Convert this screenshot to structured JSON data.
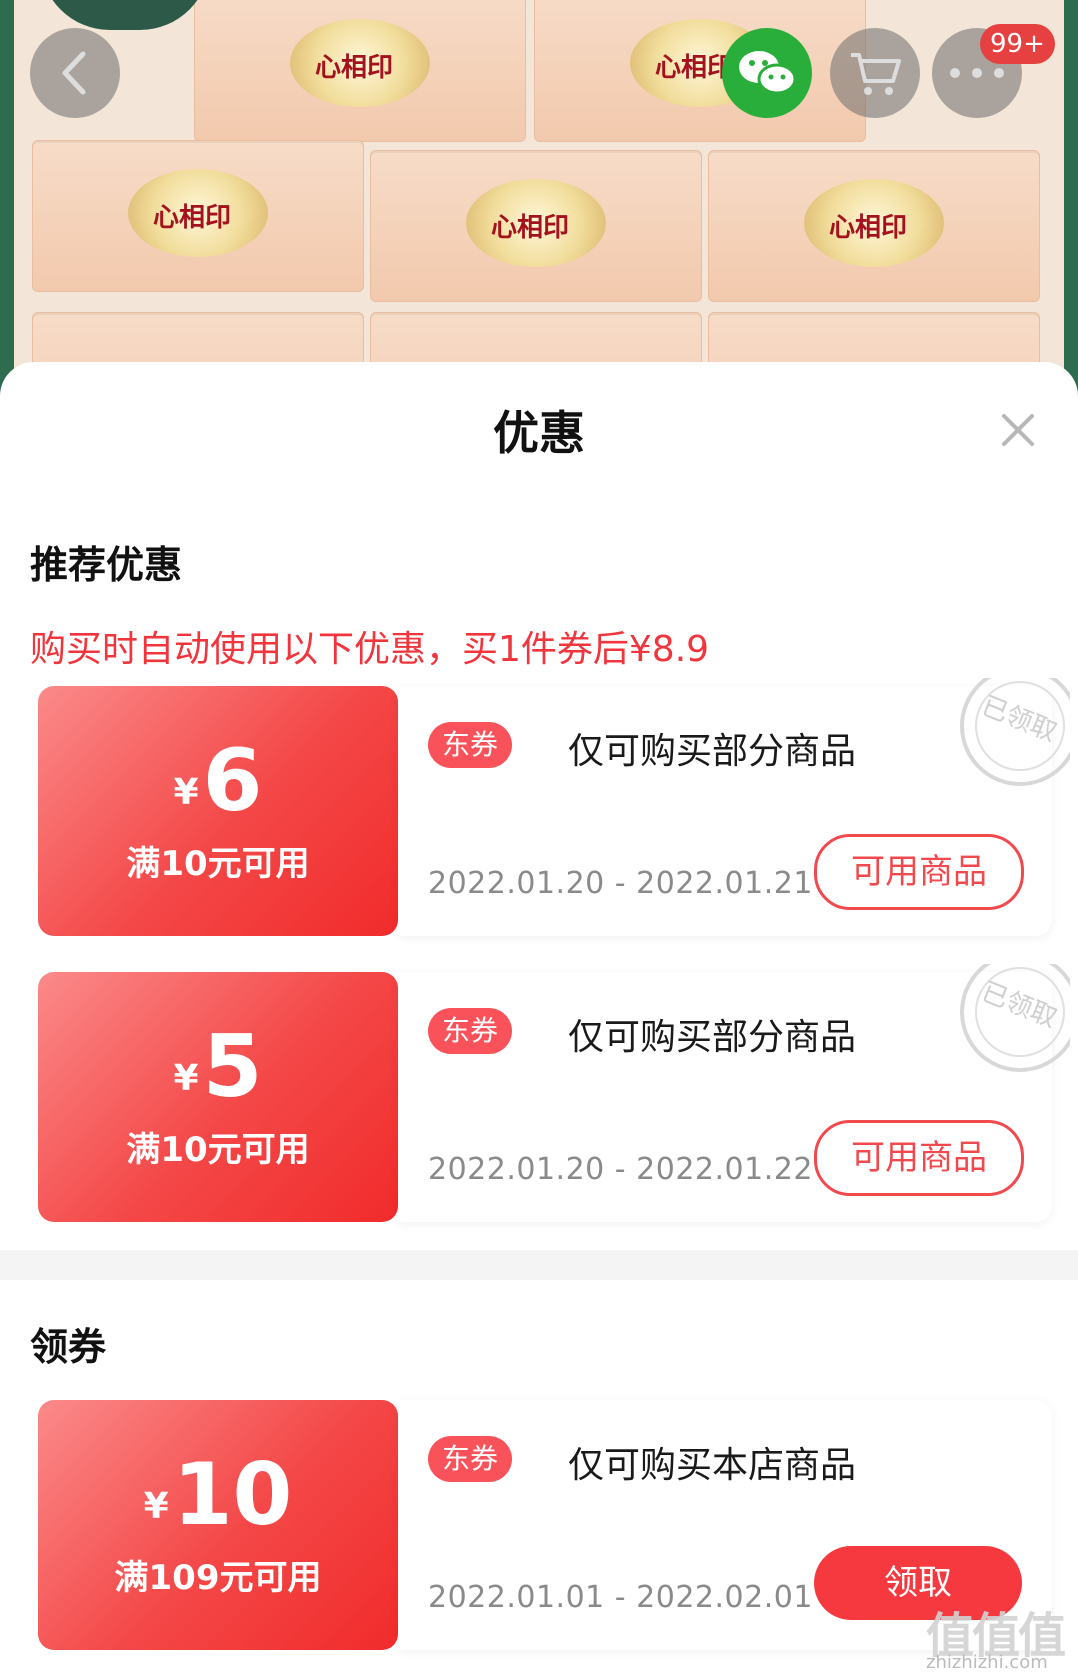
{
  "hero": {
    "brand_text": "心相印",
    "cart_badge": "99+"
  },
  "sheet": {
    "title": "优惠",
    "recommended_section_title": "推荐优惠",
    "notice": "购买时自动使用以下优惠，买1件券后¥8.9",
    "claim_section_title": "领券"
  },
  "coupons_recommended": [
    {
      "currency": "¥",
      "amount": "6",
      "condition": "满10元可用",
      "tag": "东券",
      "description": "仅可购买部分商品",
      "date_range": "2022.01.20 - 2022.01.21",
      "action_label": "可用商品",
      "stamp_text": "已领取"
    },
    {
      "currency": "¥",
      "amount": "5",
      "condition": "满10元可用",
      "tag": "东券",
      "description": "仅可购买部分商品",
      "date_range": "2022.01.20 - 2022.01.22",
      "action_label": "可用商品",
      "stamp_text": "已领取"
    }
  ],
  "coupons_claim": [
    {
      "currency": "¥",
      "amount": "10",
      "condition": "满109元可用",
      "tag": "东券",
      "description": "仅可购买本店商品",
      "date_range": "2022.01.01 - 2022.02.01",
      "action_label": "领取"
    }
  ],
  "watermark": {
    "glyph": "值值值",
    "text": "zhizhizhi.com"
  },
  "colors": {
    "accent_red": "#f5393f",
    "wechat_green": "#2aae3b",
    "hero_green": "#2f6b4f"
  }
}
